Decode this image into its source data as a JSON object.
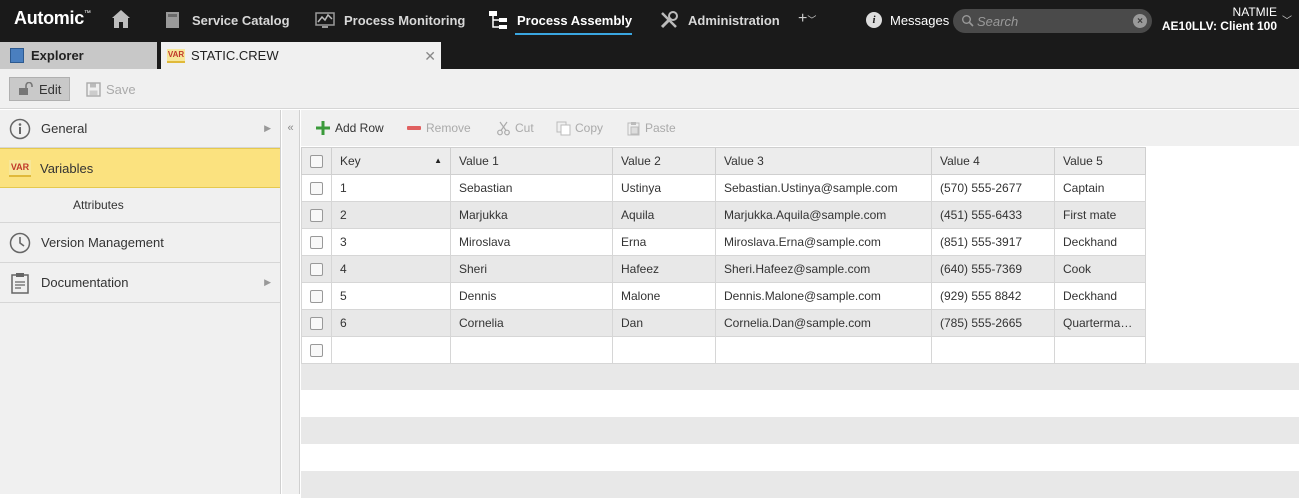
{
  "topbar": {
    "logo": "Automic",
    "nav": [
      {
        "label": "Service Catalog"
      },
      {
        "label": "Process Monitoring"
      },
      {
        "label": "Process Assembly"
      },
      {
        "label": "Administration"
      }
    ],
    "plus_label": "+",
    "messages_label": "Messages",
    "search_placeholder": "Search",
    "user_name": "NATMIE",
    "user_client": "AE10LLV: Client 100"
  },
  "tabs": {
    "explorer_label": "Explorer",
    "doc_badge": "VAR",
    "doc_label": "STATIC.CREW"
  },
  "toolbar": {
    "edit_label": "Edit",
    "save_label": "Save"
  },
  "leftpanel": {
    "items": [
      {
        "label": "General"
      },
      {
        "label": "Variables",
        "badge": "VAR"
      },
      {
        "label": "Attributes"
      },
      {
        "label": "Version Management"
      },
      {
        "label": "Documentation"
      }
    ]
  },
  "grid_toolbar": {
    "add_row": "Add Row",
    "remove": "Remove",
    "cut": "Cut",
    "copy": "Copy",
    "paste": "Paste"
  },
  "table": {
    "headers": [
      "Key",
      "Value 1",
      "Value 2",
      "Value 3",
      "Value 4",
      "Value 5"
    ],
    "rows": [
      [
        "1",
        "Sebastian",
        "Ustinya",
        "Sebastian.Ustinya@sample.com",
        "(570) 555-2677",
        "Captain"
      ],
      [
        "2",
        "Marjukka",
        "Aquila",
        "Marjukka.Aquila@sample.com",
        "(451) 555-6433",
        "First mate"
      ],
      [
        "3",
        "Miroslava",
        "Erna",
        "Miroslava.Erna@sample.com",
        "(851) 555-3917",
        "Deckhand"
      ],
      [
        "4",
        "Sheri",
        "Hafeez",
        "Sheri.Hafeez@sample.com",
        "(640) 555-7369",
        "Cook"
      ],
      [
        "5",
        "Dennis",
        "Malone",
        "Dennis.Malone@sample.com",
        "(929) 555 8842",
        "Deckhand"
      ],
      [
        "6",
        "Cornelia",
        "Dan",
        "Cornelia.Dan@sample.com",
        "(785) 555-2665",
        "Quarterma…"
      ]
    ]
  },
  "colors": {
    "topbar_bg": "#1a1a1a",
    "selection_yellow": "#fbe27f",
    "active_underline": "#3aa6e0",
    "add_green": "#3a9a3a",
    "remove_red": "#e06060"
  }
}
